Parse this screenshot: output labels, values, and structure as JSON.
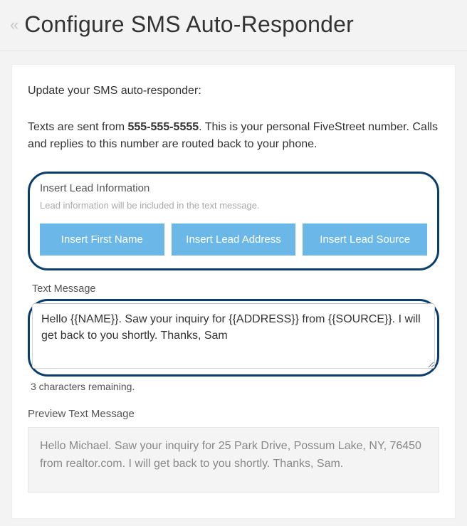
{
  "header": {
    "title": "Configure SMS Auto-Responder"
  },
  "intro": "Update your SMS auto-responder:",
  "info": {
    "prefix": "Texts are sent from ",
    "phone": "555-555-5555",
    "suffix": ". This is your personal FiveStreet number. Calls and replies to this number are routed back to your phone."
  },
  "lead_section": {
    "title": "Insert Lead Information",
    "subtitle": "Lead information will be included in the text message.",
    "buttons": {
      "first_name": "Insert First Name",
      "lead_address": "Insert Lead Address",
      "lead_source": "Insert Lead Source"
    }
  },
  "text_message": {
    "label": "Text Message",
    "value": "Hello {{NAME}}. Saw your inquiry for {{ADDRESS}} from {{SOURCE}}. I will get back to you shortly. Thanks, Sam",
    "counter": "3 characters remaining."
  },
  "preview": {
    "label": "Preview Text Message",
    "text": "Hello Michael. Saw your inquiry for 25 Park Drive, Possum Lake, NY, 76450 from realtor.com. I will get back to you shortly. Thanks, Sam."
  }
}
